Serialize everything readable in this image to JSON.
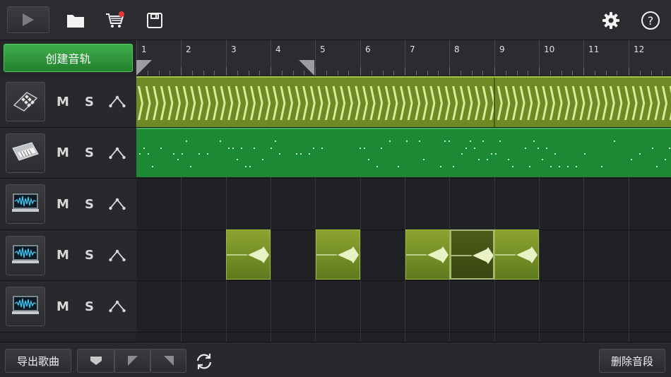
{
  "toolbar": {
    "icons": [
      "play-icon",
      "folder-icon",
      "cart-icon",
      "save-icon",
      "gear-icon",
      "help-icon"
    ],
    "help_glyph": "?",
    "cart_badge_color": "#e53935"
  },
  "create_track_label": "创建音轨",
  "ruler": {
    "bars": [
      "1",
      "2",
      "3",
      "4",
      "5",
      "6",
      "7",
      "8",
      "9",
      "10",
      "11",
      "12"
    ]
  },
  "tracks": [
    {
      "instrument": "drum-pad-icon",
      "mute": "M",
      "solo": "S"
    },
    {
      "instrument": "keyboard-icon",
      "mute": "M",
      "solo": "S"
    },
    {
      "instrument": "audio-wave-icon",
      "mute": "M",
      "solo": "S"
    },
    {
      "instrument": "audio-wave-icon",
      "mute": "M",
      "solo": "S"
    },
    {
      "instrument": "audio-wave-icon",
      "mute": "M",
      "solo": "S"
    }
  ],
  "colors": {
    "accent_green": "#2e9a3b",
    "drum_segment": "#6e8a24",
    "keys_segment": "#1c8a34",
    "audio_segment": "#8ca531"
  },
  "bottombar": {
    "export_label": "导出歌曲",
    "delete_label": "删除音段",
    "snap_icons": [
      "snap-down-icon",
      "snap-left-icon",
      "snap-right-icon"
    ],
    "loop_icon": "loop-icon"
  }
}
